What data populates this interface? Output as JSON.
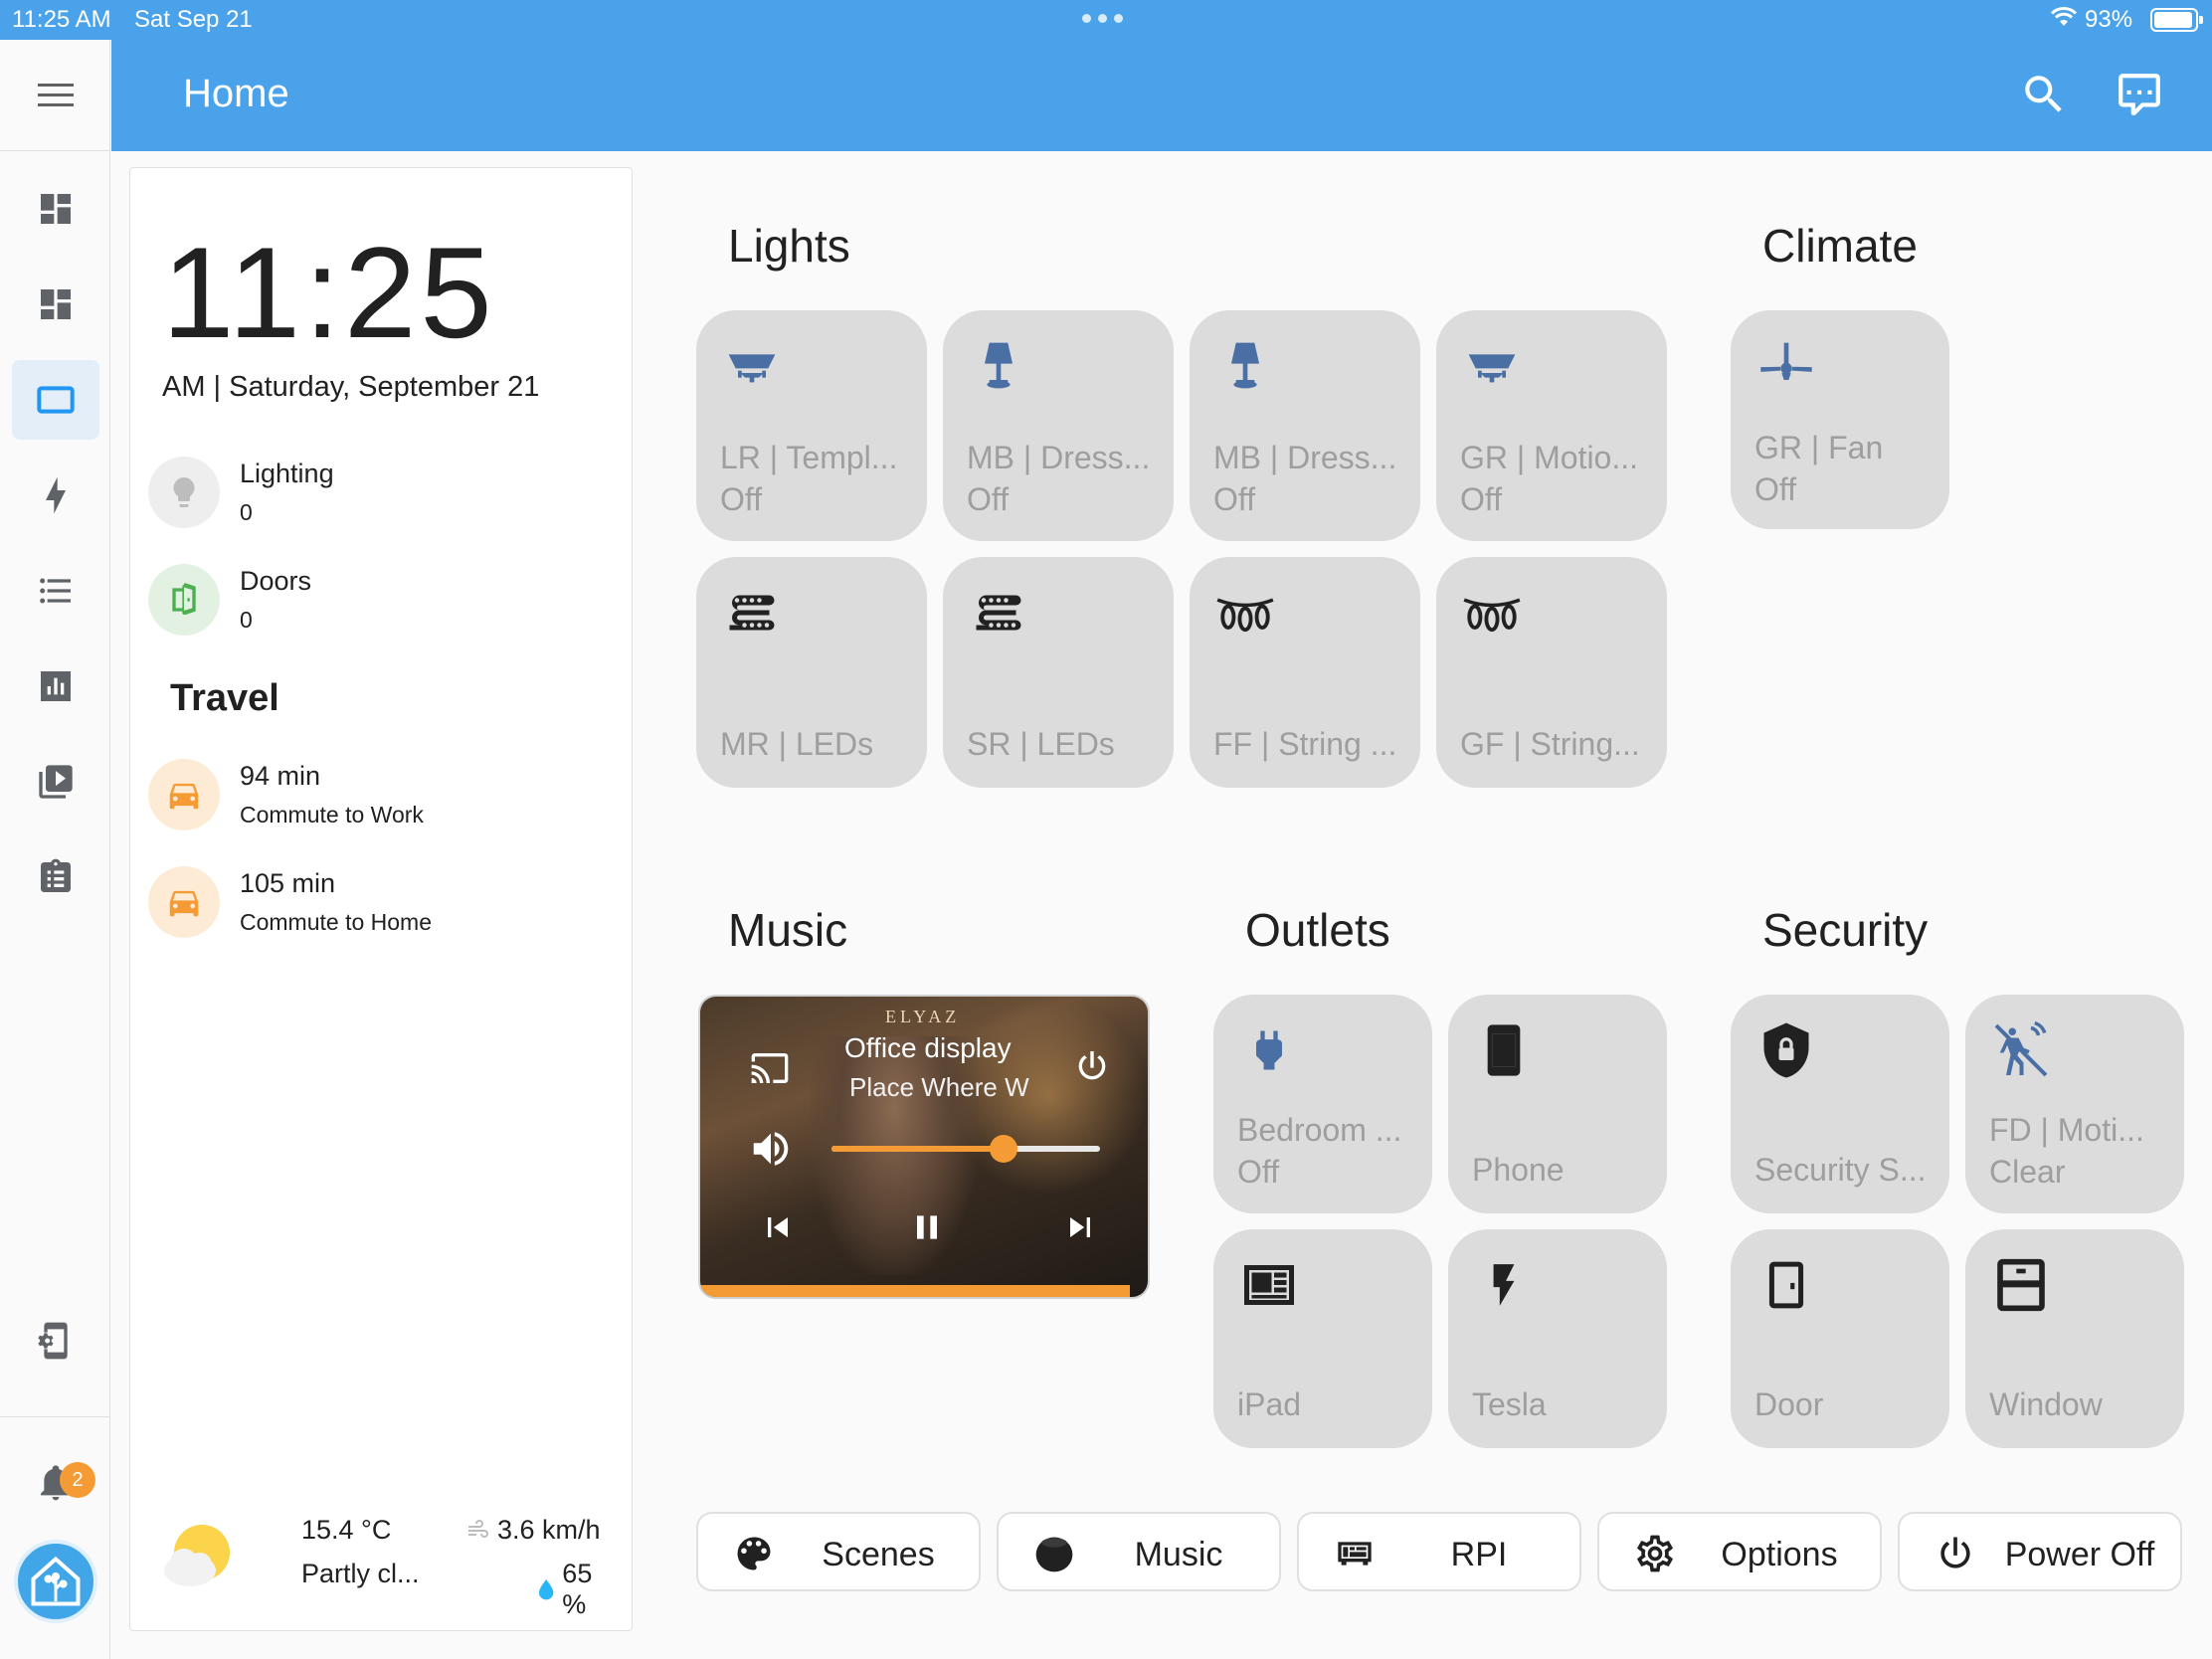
{
  "status_bar": {
    "time": "11:25 AM",
    "date": "Sat Sep 21",
    "battery": "93%",
    "battery_level": 0.93
  },
  "app_bar": {
    "title": "Home"
  },
  "colors": {
    "primary": "#4aa3ea",
    "accent": "#f59b35",
    "tile_bg": "#dcdcdc",
    "icon_blue": "#4a6fa5",
    "green": "#4caf50"
  },
  "sidebar": {
    "items": [
      {
        "name": "overview-icon"
      },
      {
        "name": "dashboard-icon"
      },
      {
        "name": "tablet-icon"
      },
      {
        "name": "energy-icon"
      },
      {
        "name": "logbook-icon"
      },
      {
        "name": "history-icon"
      },
      {
        "name": "media-icon"
      },
      {
        "name": "todo-icon"
      }
    ],
    "notification_count": "2"
  },
  "info_card": {
    "clock": "11:25",
    "date": "AM | Saturday, September 21",
    "entities": [
      {
        "name": "Lighting",
        "value": "0",
        "icon": "lightbulb-icon"
      },
      {
        "name": "Doors",
        "value": "0",
        "icon": "door-open-icon"
      }
    ],
    "travel_title": "Travel",
    "travel": [
      {
        "time": "94 min",
        "label": "Commute to Work",
        "icon": "car-icon"
      },
      {
        "time": "105 min",
        "label": "Commute to Home",
        "icon": "car-icon"
      }
    ],
    "weather": {
      "temperature": "15.4 °C",
      "condition": "Partly cl...",
      "wind": "3.6 km/h",
      "humidity": "65 %"
    }
  },
  "sections": {
    "lights": "Lights",
    "climate": "Climate",
    "music": "Music",
    "outlets": "Outlets",
    "security": "Security"
  },
  "lights": [
    {
      "name": "LR | Templ...",
      "state": "Off",
      "icon": "ceiling-light-icon"
    },
    {
      "name": "MB | Dress...",
      "state": "Off",
      "icon": "lamp-icon"
    },
    {
      "name": "MB | Dress...",
      "state": "Off",
      "icon": "lamp-icon"
    },
    {
      "name": "GR | Motio...",
      "state": "Off",
      "icon": "ceiling-light-icon"
    },
    {
      "name": "MR | LEDs",
      "state": "",
      "icon": "led-strip-icon"
    },
    {
      "name": "SR | LEDs",
      "state": "",
      "icon": "led-strip-icon"
    },
    {
      "name": "FF | String ...",
      "state": "",
      "icon": "string-lights-icon"
    },
    {
      "name": "GF | String...",
      "state": "",
      "icon": "string-lights-icon"
    }
  ],
  "climate": [
    {
      "name": "GR | Fan",
      "state": "Off",
      "icon": "ceiling-fan-icon"
    }
  ],
  "music": {
    "band": "ELYAZ",
    "player": "Office display",
    "track": "Place Where W",
    "volume": 0.64,
    "progress": 0.96
  },
  "outlets": [
    {
      "name": "Bedroom ...",
      "state": "Off",
      "icon": "power-plug-icon"
    },
    {
      "name": "Phone",
      "state": "",
      "icon": "cellphone-icon"
    },
    {
      "name": "iPad",
      "state": "",
      "icon": "newspaper-icon"
    },
    {
      "name": "Tesla",
      "state": "",
      "icon": "flash-icon"
    }
  ],
  "security": [
    {
      "name": "Security S...",
      "state": "",
      "icon": "shield-lock-icon"
    },
    {
      "name": "FD | Moti...",
      "state": "Clear",
      "icon": "motion-sensor-off-icon"
    },
    {
      "name": "Door",
      "state": "",
      "icon": "door-icon"
    },
    {
      "name": "Window",
      "state": "",
      "icon": "window-icon"
    }
  ],
  "buttons": [
    {
      "label": "Scenes",
      "icon": "palette-icon"
    },
    {
      "label": "Music",
      "icon": "speaker-icon"
    },
    {
      "label": "RPI",
      "icon": "expansion-card-icon"
    },
    {
      "label": "Options",
      "icon": "cog-icon"
    },
    {
      "label": "Power Off",
      "icon": "power-icon"
    }
  ]
}
